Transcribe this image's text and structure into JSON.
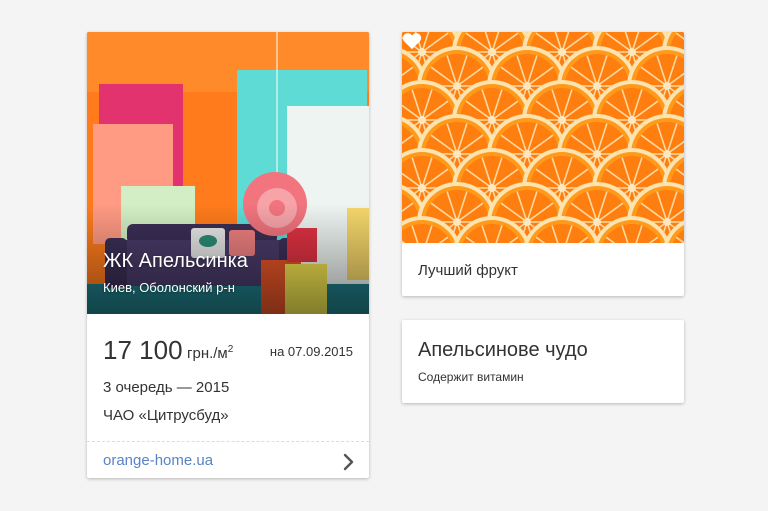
{
  "listing": {
    "title": "ЖК Апельсинка",
    "location": "Киев, Оболонский р-н",
    "price": "17 100",
    "price_unit": "грн./м",
    "price_unit_sup": "2",
    "price_date": "на 07.09.2015",
    "phase": "3 очередь — 2015",
    "developer": "ЧАО «Цитрусбуд»",
    "site": "orange-home.ua",
    "chevron_icon": "chevron-right-icon"
  },
  "orange_card": {
    "caption": "Лучший фрукт",
    "heart_icon": "heart-icon"
  },
  "miracle_card": {
    "title": "Апельсинове чудо",
    "subtitle": "Содержит витамин"
  },
  "colors": {
    "link": "#5a83c4",
    "text": "#333333",
    "background": "#f4f4f4",
    "orange": "#ff7a1a"
  }
}
